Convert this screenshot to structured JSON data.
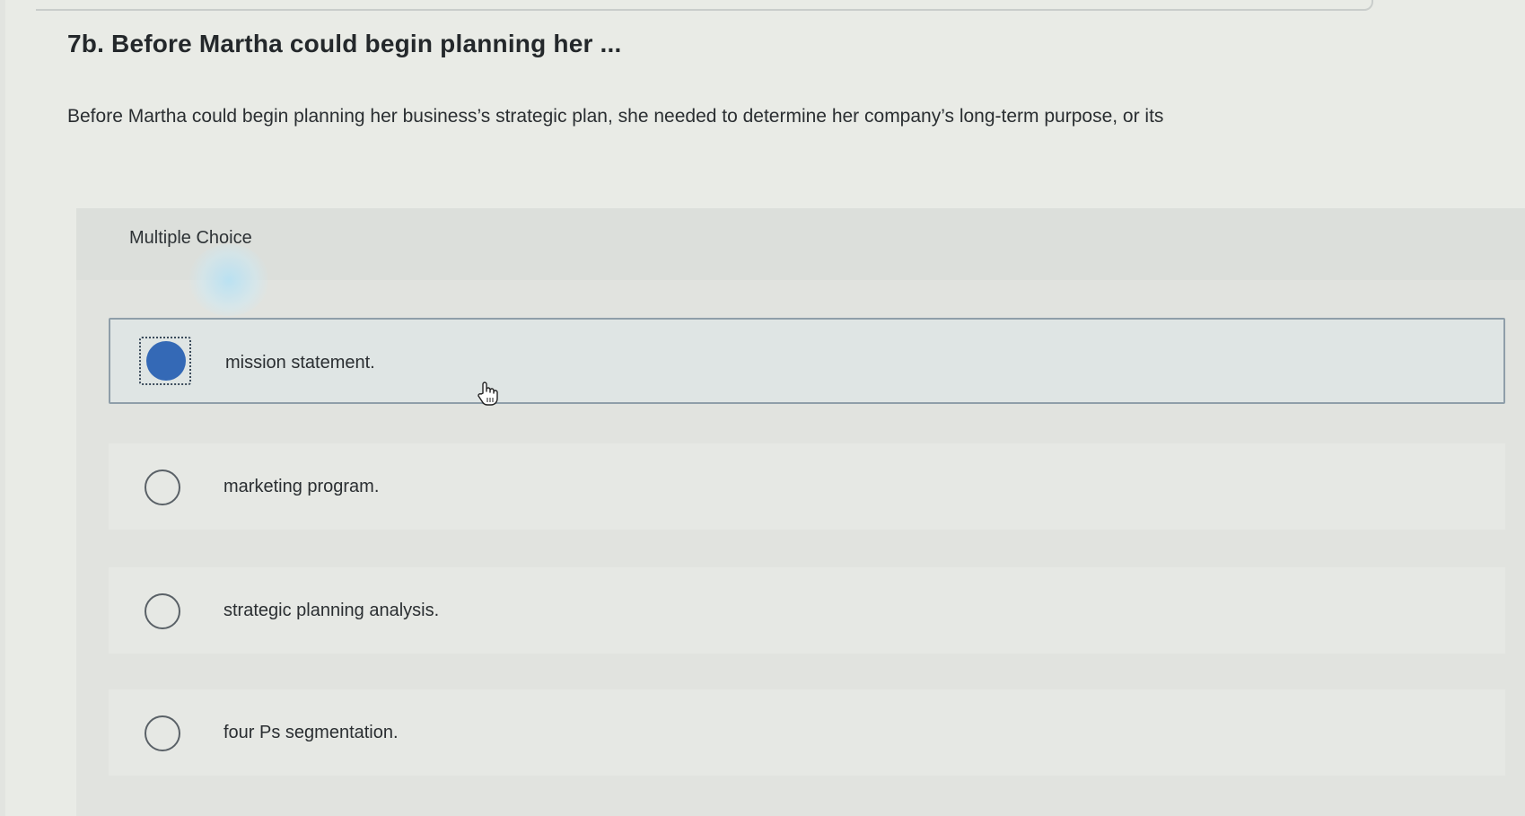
{
  "question": {
    "title": "7b. Before Martha could begin planning her ...",
    "text": "Before Martha could begin planning her business’s strategic plan, she needed to determine her company’s long-term purpose, or its"
  },
  "choice_block": {
    "type_label": "Multiple Choice",
    "selected_index": 0,
    "options": [
      {
        "label": "mission statement.",
        "selected": true
      },
      {
        "label": "marketing program.",
        "selected": false
      },
      {
        "label": "strategic planning analysis.",
        "selected": false
      },
      {
        "label": "four Ps segmentation.",
        "selected": false
      }
    ]
  },
  "colors": {
    "radio_selected": "#3469b6",
    "selected_border": "#8f9ea9",
    "background": "#e9ebe6"
  },
  "icons": {
    "cursor": "hand-pointer-icon"
  }
}
